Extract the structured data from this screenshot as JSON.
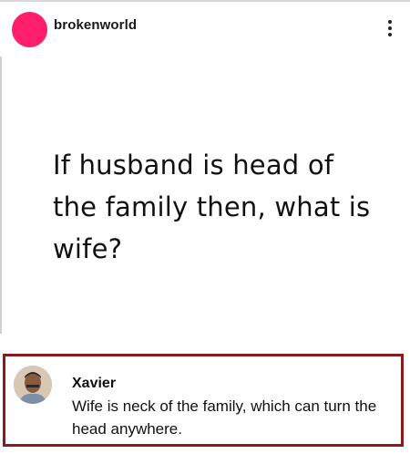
{
  "post": {
    "username": "brokenworld",
    "avatar_color": "#ff1f6b",
    "more_icon": "more-vertical-icon",
    "text": "If husband is head of the family then, what is wife?"
  },
  "comment": {
    "author": "Xavier",
    "text": "Wife is neck of the family, which can turn the head anywhere.",
    "highlight_color": "#8b1a1f"
  }
}
